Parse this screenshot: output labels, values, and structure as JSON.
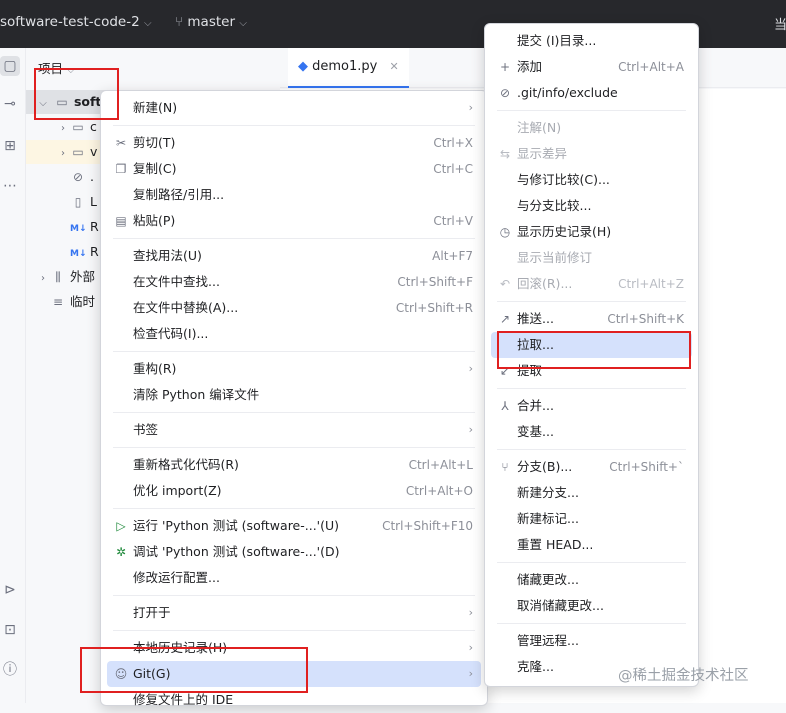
{
  "titlebar": {
    "project": "software-test-code-2",
    "branch": "master",
    "right_glyph": "当"
  },
  "project_panel": {
    "header": "项目",
    "root": "soft",
    "children": [
      "c",
      "v",
      ".",
      "L",
      "R",
      "R"
    ],
    "external": "外部",
    "scratch": "临时"
  },
  "tab": {
    "label": "demo1.py"
  },
  "context_menu": {
    "items": [
      {
        "label": "新建(N)",
        "shortcut": "",
        "submenu": true
      },
      {
        "label": "剪切(T)",
        "shortcut": "Ctrl+X",
        "icon": "scissors-icon"
      },
      {
        "label": "复制(C)",
        "shortcut": "Ctrl+C",
        "icon": "copy-icon"
      },
      {
        "label": "复制路径/引用...",
        "shortcut": ""
      },
      {
        "label": "粘贴(P)",
        "shortcut": "Ctrl+V",
        "icon": "paste-icon"
      },
      {
        "label": "查找用法(U)",
        "shortcut": "Alt+F7"
      },
      {
        "label": "在文件中查找...",
        "shortcut": "Ctrl+Shift+F"
      },
      {
        "label": "在文件中替换(A)...",
        "shortcut": "Ctrl+Shift+R"
      },
      {
        "label": "检查代码(I)...",
        "shortcut": ""
      },
      {
        "label": "重构(R)",
        "shortcut": "",
        "submenu": true
      },
      {
        "label": "清除 Python 编译文件",
        "shortcut": ""
      },
      {
        "label": "书签",
        "shortcut": "",
        "submenu": true
      },
      {
        "label": "重新格式化代码(R)",
        "shortcut": "Ctrl+Alt+L"
      },
      {
        "label": "优化 import(Z)",
        "shortcut": "Ctrl+Alt+O"
      },
      {
        "label": "运行 'Python 测试 (software-...'(U)",
        "shortcut": "Ctrl+Shift+F10",
        "icon": "run-icon"
      },
      {
        "label": "调试 'Python 测试 (software-...'(D)",
        "shortcut": "",
        "icon": "debug-icon"
      },
      {
        "label": "修改运行配置...",
        "shortcut": ""
      },
      {
        "label": "打开于",
        "shortcut": "",
        "submenu": true
      },
      {
        "label": "本地历史记录(H)",
        "shortcut": "",
        "submenu": true
      },
      {
        "label": "Git(G)",
        "shortcut": "",
        "submenu": true,
        "icon": "git-icon"
      },
      {
        "label": "修复文件上的 IDE",
        "shortcut": ""
      }
    ]
  },
  "git_menu": {
    "items": [
      {
        "label": "提交 (I)目录...",
        "shortcut": ""
      },
      {
        "label": "添加",
        "shortcut": "Ctrl+Alt+A",
        "icon": "plus-icon"
      },
      {
        "label": ".git/info/exclude",
        "shortcut": "",
        "icon": "ignore-icon"
      },
      {
        "label": "注解(N)",
        "shortcut": "",
        "disabled": true
      },
      {
        "label": "显示差异",
        "shortcut": "",
        "disabled": true,
        "icon": "diff-icon"
      },
      {
        "label": "与修订比较(C)...",
        "shortcut": ""
      },
      {
        "label": "与分支比较...",
        "shortcut": ""
      },
      {
        "label": "显示历史记录(H)",
        "shortcut": "",
        "icon": "history-icon"
      },
      {
        "label": "显示当前修订",
        "shortcut": "",
        "disabled": true
      },
      {
        "label": "回滚(R)...",
        "shortcut": "Ctrl+Alt+Z",
        "disabled": true,
        "icon": "rollback-icon"
      },
      {
        "label": "推送...",
        "shortcut": "Ctrl+Shift+K",
        "icon": "push-icon"
      },
      {
        "label": "拉取...",
        "shortcut": ""
      },
      {
        "label": "提取",
        "shortcut": "",
        "icon": "fetch-icon"
      },
      {
        "label": "合并...",
        "shortcut": "",
        "icon": "merge-icon"
      },
      {
        "label": "变基...",
        "shortcut": ""
      },
      {
        "label": "分支(B)...",
        "shortcut": "Ctrl+Shift+`",
        "icon": "branch-icon"
      },
      {
        "label": "新建分支...",
        "shortcut": ""
      },
      {
        "label": "新建标记...",
        "shortcut": ""
      },
      {
        "label": "重置 HEAD...",
        "shortcut": ""
      },
      {
        "label": "储藏更改...",
        "shortcut": ""
      },
      {
        "label": "取消储藏更改...",
        "shortcut": ""
      },
      {
        "label": "管理远程...",
        "shortcut": ""
      },
      {
        "label": "克隆...",
        "shortcut": ""
      }
    ]
  },
  "watermark": "@稀土掘金技术社区",
  "colors": {
    "accent": "#3574f0",
    "selection": "#d5e1fc",
    "annotation": "#e02020",
    "titlebar": "#27282c"
  }
}
